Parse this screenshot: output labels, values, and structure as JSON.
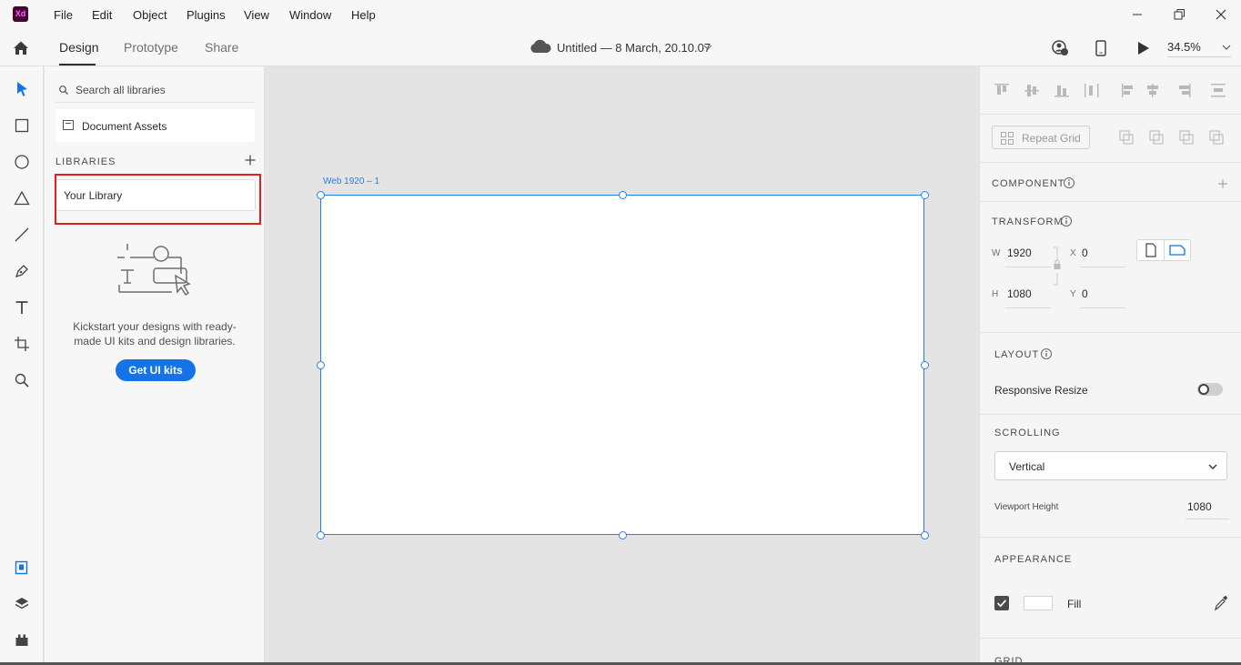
{
  "app": {
    "logo": "Xd"
  },
  "menu": [
    "File",
    "Edit",
    "Object",
    "Plugins",
    "View",
    "Window",
    "Help"
  ],
  "tabs": [
    "Design",
    "Prototype",
    "Share"
  ],
  "document": {
    "title": "Untitled — 8 March, 20.10.07"
  },
  "zoom": "34.5%",
  "libraries": {
    "search_placeholder": "Search all libraries",
    "document_assets": "Document Assets",
    "heading": "LIBRARIES",
    "library_name": "Your Library",
    "kickstart_text": "Kickstart your designs with ready-made UI kits and design libraries.",
    "get_button": "Get UI kits"
  },
  "artboard": {
    "label": "Web 1920 – 1"
  },
  "properties": {
    "repeat_grid": "Repeat Grid",
    "component_heading": "COMPONENT",
    "transform_heading": "TRANSFORM",
    "w_label": "W",
    "w_value": "1920",
    "h_label": "H",
    "h_value": "1080",
    "x_label": "X",
    "x_value": "0",
    "y_label": "Y",
    "y_value": "0",
    "layout_heading": "LAYOUT",
    "responsive_resize": "Responsive Resize",
    "scrolling_heading": "SCROLLING",
    "scrolling_value": "Vertical",
    "viewport_label": "Viewport Height",
    "viewport_value": "1080",
    "appearance_heading": "APPEARANCE",
    "fill_label": "Fill",
    "grid_heading": "GRID"
  },
  "colors": {
    "accent": "#1473e6",
    "selection": "#2680eb",
    "highlight": "#e02020"
  }
}
